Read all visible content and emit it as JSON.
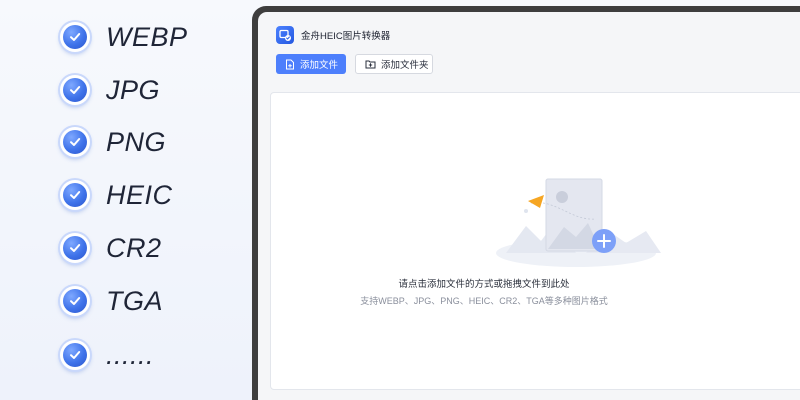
{
  "formats": [
    {
      "label": "WEBP"
    },
    {
      "label": "JPG"
    },
    {
      "label": "PNG"
    },
    {
      "label": "HEIC"
    },
    {
      "label": "CR2"
    },
    {
      "label": "TGA"
    },
    {
      "label": "......"
    }
  ],
  "app": {
    "title": "金舟HEIC图片转换器",
    "logo_icon": "app-logo-icon"
  },
  "toolbar": {
    "add_file_label": "添加文件",
    "add_folder_label": "添加文件夹"
  },
  "dropzone": {
    "hint": "请点击添加文件的方式或拖拽文件到此处",
    "sub": "支持WEBP、JPG、PNG、HEIC、CR2、TGA等多种图片格式"
  },
  "colors": {
    "accent": "#4d7ffc",
    "check": "#3f73ea",
    "frame": "#3e3e3e"
  }
}
